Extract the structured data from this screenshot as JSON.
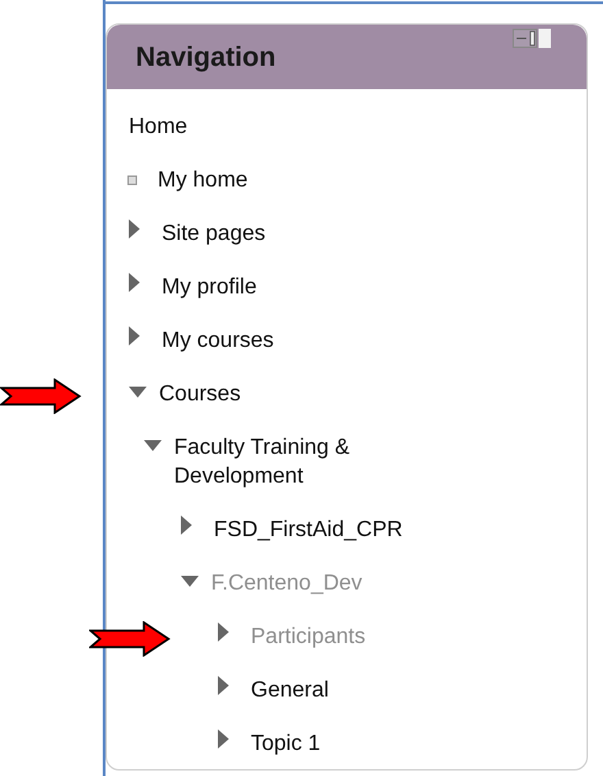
{
  "block": {
    "title": "Navigation"
  },
  "tree": [
    {
      "label": "Home",
      "kind": "plain",
      "dimmed": false,
      "marked": false
    },
    {
      "label": "My home",
      "kind": "leaf",
      "dimmed": false,
      "marked": false
    },
    {
      "label": "Site pages",
      "kind": "branch",
      "expanded": false,
      "dimmed": false,
      "marked": false
    },
    {
      "label": "My profile",
      "kind": "branch",
      "expanded": false,
      "dimmed": false,
      "marked": false
    },
    {
      "label": "My courses",
      "kind": "branch",
      "expanded": false,
      "dimmed": false,
      "marked": false
    },
    {
      "label": "Courses",
      "kind": "branch",
      "expanded": true,
      "dimmed": false,
      "marked": true,
      "children": [
        {
          "label": "Faculty Training & Development",
          "kind": "branch",
          "expanded": true,
          "dimmed": false,
          "marked": false,
          "children": [
            {
              "label": "FSD_FirstAid_CPR",
              "kind": "branch",
              "expanded": false,
              "dimmed": false,
              "marked": false
            },
            {
              "label": "F.Centeno_Dev",
              "kind": "branch",
              "expanded": true,
              "dimmed": true,
              "marked": false,
              "children": [
                {
                  "label": "Participants",
                  "kind": "branch",
                  "expanded": false,
                  "dimmed": true,
                  "marked": true
                },
                {
                  "label": "General",
                  "kind": "branch",
                  "expanded": false,
                  "dimmed": false,
                  "marked": false
                },
                {
                  "label": "Topic 1",
                  "kind": "branch",
                  "expanded": false,
                  "dimmed": false,
                  "marked": false
                }
              ]
            }
          ]
        }
      ]
    }
  ]
}
